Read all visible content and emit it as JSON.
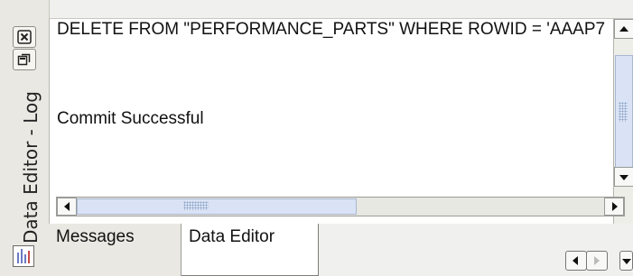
{
  "panel": {
    "title": "Data Editor - Log",
    "icons": {
      "close": "close-icon",
      "restore": "restore-window-icon",
      "log": "bar-chart-icon"
    }
  },
  "log": {
    "line1": "DELETE FROM \"PERFORMANCE_PARTS\" WHERE ROWID = 'AAAP7",
    "line2": "Commit Successful"
  },
  "tabs": [
    {
      "label": "Messages",
      "selected": false
    },
    {
      "label": "Data Editor",
      "selected": true
    }
  ],
  "scroll": {
    "vertical_position": 0.5,
    "horizontal_position": 0.0
  }
}
